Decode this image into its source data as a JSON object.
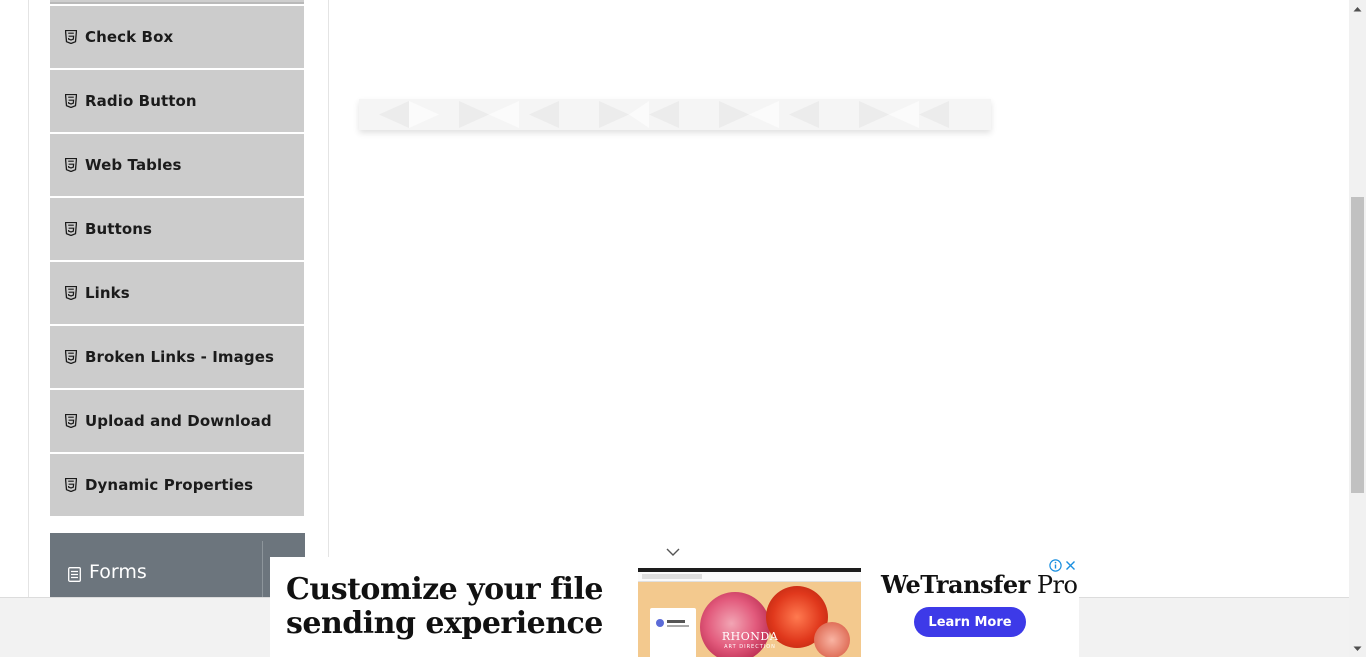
{
  "sidebar": {
    "items": [
      {
        "label": "Check Box",
        "icon": "html5-icon"
      },
      {
        "label": "Radio Button",
        "icon": "html5-icon"
      },
      {
        "label": "Web Tables",
        "icon": "html5-icon"
      },
      {
        "label": "Buttons",
        "icon": "html5-icon"
      },
      {
        "label": "Links",
        "icon": "html5-icon"
      },
      {
        "label": "Broken Links - Images",
        "icon": "html5-icon"
      },
      {
        "label": "Upload and Download",
        "icon": "html5-icon"
      },
      {
        "label": "Dynamic Properties",
        "icon": "html5-icon"
      }
    ],
    "group": {
      "label": "Forms",
      "icon": "document-icon"
    }
  },
  "ad": {
    "headline": "Customize your file sending experience",
    "brand_bold": "WeTransfer",
    "brand_rest": " Pro",
    "cta": "Learn More",
    "image_brand": "RHONDA",
    "image_brand_sub": "ART DIRECTION",
    "image_card_title": "Add Files"
  },
  "colors": {
    "menu_item_bg": "#cccccc",
    "group_header_bg": "#6c757d",
    "ad_cta_bg": "#3d3ae8"
  }
}
